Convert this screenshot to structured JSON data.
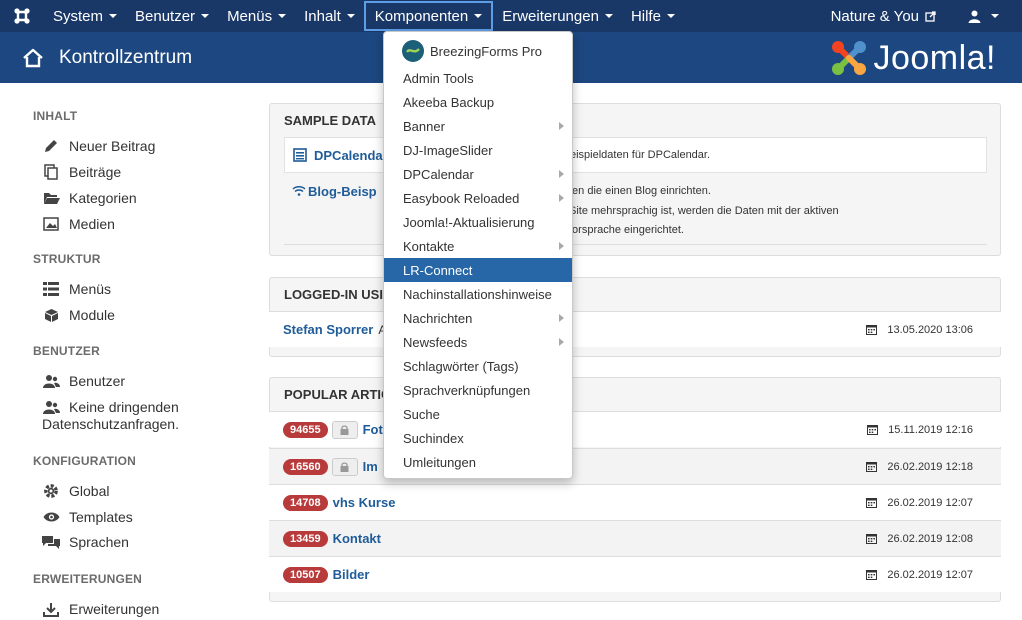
{
  "navbar": {
    "menus": [
      "System",
      "Benutzer",
      "Menüs",
      "Inhalt",
      "Komponenten",
      "Erweiterungen",
      "Hilfe"
    ],
    "site_link": "Nature & You"
  },
  "header": {
    "title": "Kontrollzentrum",
    "logo_text": "Joomla!"
  },
  "sidebar": {
    "inhalt_head": "INHALT",
    "neuer_beitrag": "Neuer Beitrag",
    "beitraege": "Beiträge",
    "kategorien": "Kategorien",
    "medien": "Medien",
    "struktur_head": "STRUKTUR",
    "menues": "Menüs",
    "module": "Module",
    "benutzer_head": "BENUTZER",
    "benutzer": "Benutzer",
    "datenschutz_1": "Keine dringenden",
    "datenschutz_2": "Datenschutzanfragen.",
    "konfig_head": "KONFIGURATION",
    "global": "Global",
    "templates": "Templates",
    "sprachen": "Sprachen",
    "erw_head": "ERWEITERUNGEN",
    "erweiterungen": "Erweiterungen"
  },
  "sample_data": {
    "title": "SAMPLE DATA",
    "item1_link": "DPCalenda",
    "item1_desc": "eispieldaten für DPCalendar.",
    "item2_link": "Blog-Beisp",
    "item2_desc_1": "ten die einen Blog einrichten.",
    "item2_desc_2": "Site mehrsprachig ist, werden die Daten mit der aktiven",
    "item2_desc_3": "torsprache eingerichtet."
  },
  "logged_in": {
    "title": "LOGGED-IN USI",
    "user": "Stefan Sporrer",
    "user_suffix": "A",
    "date": "13.05.2020 13:06"
  },
  "popular": {
    "title": "POPULAR ARTIC",
    "rows": [
      {
        "hits": "94655",
        "title": "Fot",
        "date": "15.11.2019 12:16"
      },
      {
        "hits": "16560",
        "title": "Im",
        "date": "26.02.2019 12:18"
      },
      {
        "hits": "14708",
        "title": "vhs Kurse",
        "date": "26.02.2019 12:07"
      },
      {
        "hits": "13459",
        "title": "Kontakt",
        "date": "26.02.2019 12:08"
      },
      {
        "hits": "10507",
        "title": "Bilder",
        "date": "26.02.2019 12:07"
      }
    ]
  },
  "dropdown": {
    "items": [
      "BreezingForms Pro",
      "Admin Tools",
      "Akeeba Backup",
      "Banner",
      "DJ-ImageSlider",
      "DPCalendar",
      "Easybook Reloaded",
      "Joomla!-Aktualisierung",
      "Kontakte",
      "LR-Connect",
      "Nachinstallationshinweise",
      "Nachrichten",
      "Newsfeeds",
      "Schlagwörter (Tags)",
      "Sprachverknüpfungen",
      "Suche",
      "Suchindex",
      "Umleitungen"
    ]
  },
  "colors": {
    "navbar": "#1a3867",
    "header": "#1d4780",
    "highlight": "#2767a8",
    "badge": "#b83a3a",
    "link": "#1f5c99"
  }
}
